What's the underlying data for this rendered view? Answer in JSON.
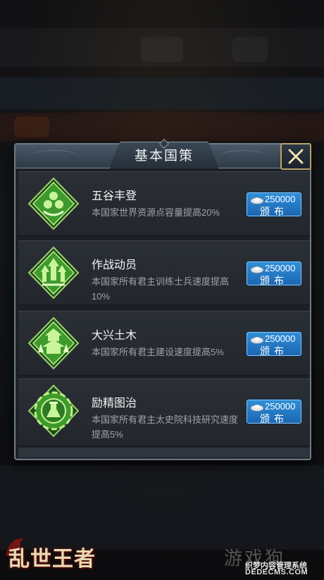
{
  "dialog": {
    "title": "基本国策",
    "close_icon": "close-icon"
  },
  "policies": [
    {
      "name": "五谷丰登",
      "description": "本国家世界资源点容量提高20%",
      "cost": "250000",
      "button_label": "颁布",
      "icon": "harvest-icon"
    },
    {
      "name": "作战动员",
      "description": "本国家所有君主训练士兵速度提高10%",
      "cost": "250000",
      "button_label": "颁布",
      "icon": "mobilization-icon"
    },
    {
      "name": "大兴土木",
      "description": "本国家所有君主建设速度提高5%",
      "cost": "250000",
      "button_label": "颁布",
      "icon": "construction-icon"
    },
    {
      "name": "励精图治",
      "description": "本国家所有君主太史院科技研究速度提高5%",
      "cost": "250000",
      "button_label": "颁布",
      "icon": "research-icon"
    }
  ],
  "branding": {
    "game_logo": "乱世王者"
  },
  "watermark": {
    "brand": "游戏狗",
    "line": "织梦内容管理系统",
    "url": "DEDECMS.COM"
  },
  "colors": {
    "button_blue": "#2f8fd8",
    "icon_green": "#5bd23d",
    "dialog_bg": "#1c1f26"
  }
}
